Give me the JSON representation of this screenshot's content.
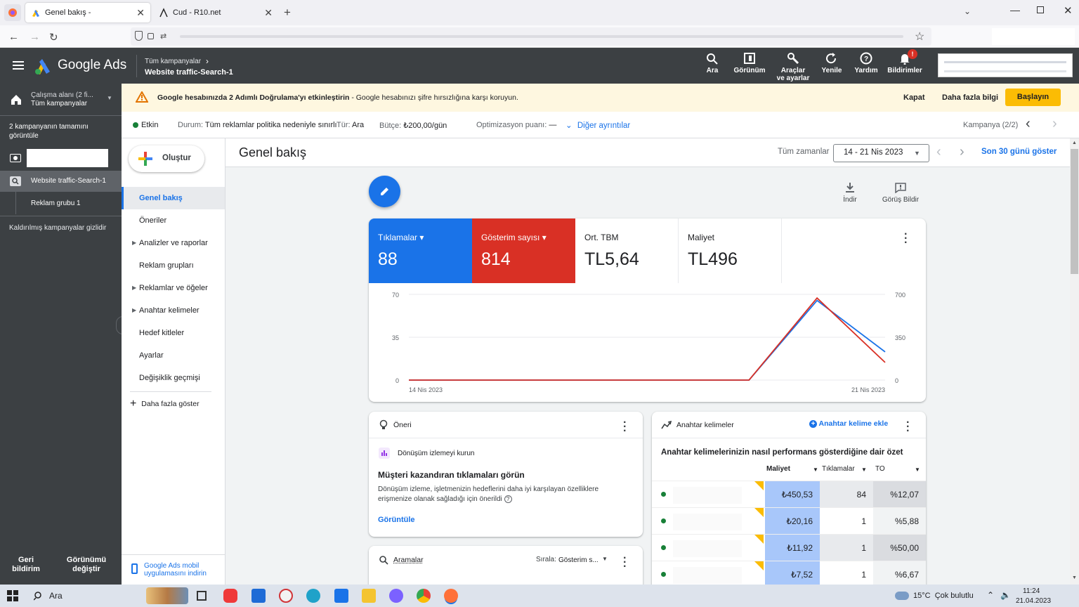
{
  "browser": {
    "tabs": [
      {
        "title": "Genel bakış -"
      },
      {
        "title": "Cud - R10.net"
      }
    ],
    "new_tab": "+"
  },
  "header": {
    "brand": "Google Ads",
    "breadcrumb_parent": "Tüm kampanyalar",
    "breadcrumb_current": "Website traffic-Search-1",
    "actions": [
      {
        "label": "Ara",
        "icon": "search-icon"
      },
      {
        "label": "Görünüm",
        "icon": "appearance-icon"
      },
      {
        "label": "Araçlar\nve ayarlar",
        "icon": "tools-icon"
      },
      {
        "label": "Yenile",
        "icon": "refresh-icon"
      },
      {
        "label": "Yardım",
        "icon": "help-icon"
      },
      {
        "label": "Bildirimler",
        "icon": "bell-icon"
      }
    ],
    "notification_badge": "!"
  },
  "banner": {
    "text_bold": "Google hesabınızda 2 Adımlı Doğrulama'yı etkinleştirin",
    "text_rest": " - Google hesabınızı şifre hırsızlığına karşı koruyun.",
    "close": "Kapat",
    "more": "Daha fazla bilgi",
    "start": "Başlayın"
  },
  "status": {
    "active": "Etkin",
    "durum_label": "Durum:",
    "durum_value": "Tüm reklamlar politika nedeniyle sınırlı",
    "tur_label": "Tür:",
    "tur_value": "Ara",
    "butce_label": "Bütçe:",
    "butce_value": "₺200,00/gün",
    "opt_label": "Optimizasyon puanı:",
    "opt_value": "—",
    "details": "Diğer ayrıntılar",
    "campaign_nav": "Kampanya (2/2)"
  },
  "left": {
    "workspace_line1": "Çalışma alanı (2 fi...",
    "workspace_line2": "Tüm kampanyalar",
    "info": "2 kampanyanın tamamını görüntüle",
    "campaign": "Website traffic-Search-1",
    "adgroup": "Reklam grubu 1",
    "hidden": "Kaldırılmış kampanyalar gizlidir",
    "feedback": "Geri bildirim",
    "view_change": "Görünümü değiştir"
  },
  "nav": {
    "create": "Oluştur",
    "items": [
      {
        "label": "Genel bakış",
        "expand": false
      },
      {
        "label": "Öneriler",
        "expand": false
      },
      {
        "label": "Analizler ve raporlar",
        "expand": true
      },
      {
        "label": "Reklam grupları",
        "expand": false
      },
      {
        "label": "Reklamlar ve öğeler",
        "expand": true
      },
      {
        "label": "Anahtar kelimeler",
        "expand": true
      },
      {
        "label": "Hedef kitleler",
        "expand": false
      },
      {
        "label": "Ayarlar",
        "expand": false
      },
      {
        "label": "Değişiklik geçmişi",
        "expand": false
      }
    ],
    "more": "Daha fazla göster",
    "app_line1": "Google Ads mobil",
    "app_line2": "uygulamasını indirin"
  },
  "main": {
    "title": "Genel bakış",
    "all_time": "Tüm zamanlar",
    "date_range": "14 - 21 Nis 2023",
    "last30": "Son 30 günü göster",
    "download": "İndir",
    "feedback": "Görüş Bildir"
  },
  "metrics": [
    {
      "label": "Tıklamalar",
      "value": "88",
      "color": "#1a73e8",
      "dropdown": true
    },
    {
      "label": "Gösterim sayısı",
      "value": "814",
      "color": "#d93025",
      "dropdown": true
    },
    {
      "label": "Ort. TBM",
      "value": "TL5,64",
      "color": "#ffffff",
      "dropdown": false
    },
    {
      "label": "Maliyet",
      "value": "TL496",
      "color": "#ffffff",
      "dropdown": false
    }
  ],
  "chart_data": {
    "type": "line",
    "x_labels": [
      "14 Nis 2023",
      "21 Nis 2023"
    ],
    "y_left_ticks": [
      "70",
      "35",
      "0"
    ],
    "y_right_ticks": [
      "700",
      "350",
      "0"
    ],
    "ylim_left": [
      0,
      70
    ],
    "ylim_right": [
      0,
      700
    ],
    "grid": true,
    "series": [
      {
        "name": "Tıklamalar",
        "axis": "left",
        "color": "#1a73e8",
        "values": [
          0,
          0,
          0,
          0,
          0,
          0,
          65,
          23
        ]
      },
      {
        "name": "Gösterim sayısı",
        "axis": "right",
        "color": "#d93025",
        "values": [
          0,
          0,
          0,
          0,
          0,
          0,
          670,
          144
        ]
      }
    ]
  },
  "recommendation": {
    "title": "Öneri",
    "item": "Dönüşüm izlemeyi kurun",
    "heading": "Müşteri kazandıran tıklamaları görün",
    "body": "Dönüşüm izleme, işletmenizin hedeflerini daha iyi karşılayan özelliklere erişmenize olanak sağladığı için önerildi",
    "link": "Görüntüle"
  },
  "searches": {
    "title": "Aramalar",
    "sort_label": "Sırala:",
    "sort_value": "Gösterim s..."
  },
  "keywords": {
    "title": "Anahtar kelimeler",
    "add": "Anahtar kelime ekle",
    "subtitle": "Anahtar kelimelerinizin nasıl performans gösterdiğine dair özet",
    "columns": [
      "Maliyet",
      "Tıklamalar",
      "TO"
    ],
    "rows": [
      {
        "cost": "₺450,53",
        "clicks": "84",
        "ctr": "%12,07"
      },
      {
        "cost": "₺20,16",
        "clicks": "1",
        "ctr": "%5,88"
      },
      {
        "cost": "₺11,92",
        "clicks": "1",
        "ctr": "%50,00"
      },
      {
        "cost": "₺7,52",
        "clicks": "1",
        "ctr": "%6,67"
      }
    ]
  },
  "taskbar": {
    "search": "Ara",
    "weather": "15°C  Çok bulutlu",
    "time": "11:24",
    "date": "21.04.2023"
  }
}
